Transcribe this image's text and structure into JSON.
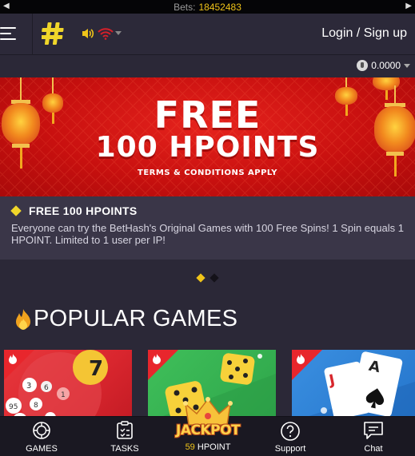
{
  "ticker": {
    "label": "Bets:",
    "value": "18452483"
  },
  "header": {
    "login_label": "Login / Sign up"
  },
  "balance": {
    "amount": "0.0000"
  },
  "banner": {
    "title_line1": "FREE",
    "title_line2": "100 HPOINTS",
    "terms": "TERMS & CONDITIONS APPLY"
  },
  "promo": {
    "title": "FREE 100 HPOINTS",
    "text": "Everyone can try the BetHash's Original Games with 100 Free Spins! 1 Spin equals 1 HPOINT. Limited to 1 user per IP!"
  },
  "carousel": {
    "count": 2,
    "active": 0
  },
  "section": {
    "title": "POPULAR GAMES"
  },
  "games": [
    {
      "icon": "keno-balls"
    },
    {
      "icon": "dice"
    },
    {
      "icon": "cards"
    }
  ],
  "tabbar": {
    "games": "GAMES",
    "tasks": "TASKS",
    "jackpot_word": "JACKPOT",
    "jackpot_count": "59",
    "jackpot_unit": "HPOINT",
    "support": "Support",
    "chat": "Chat"
  },
  "colors": {
    "accent": "#f0c419",
    "background": "#2b2837",
    "banner_red": "#c8100f",
    "tabbar": "#1a1822"
  }
}
